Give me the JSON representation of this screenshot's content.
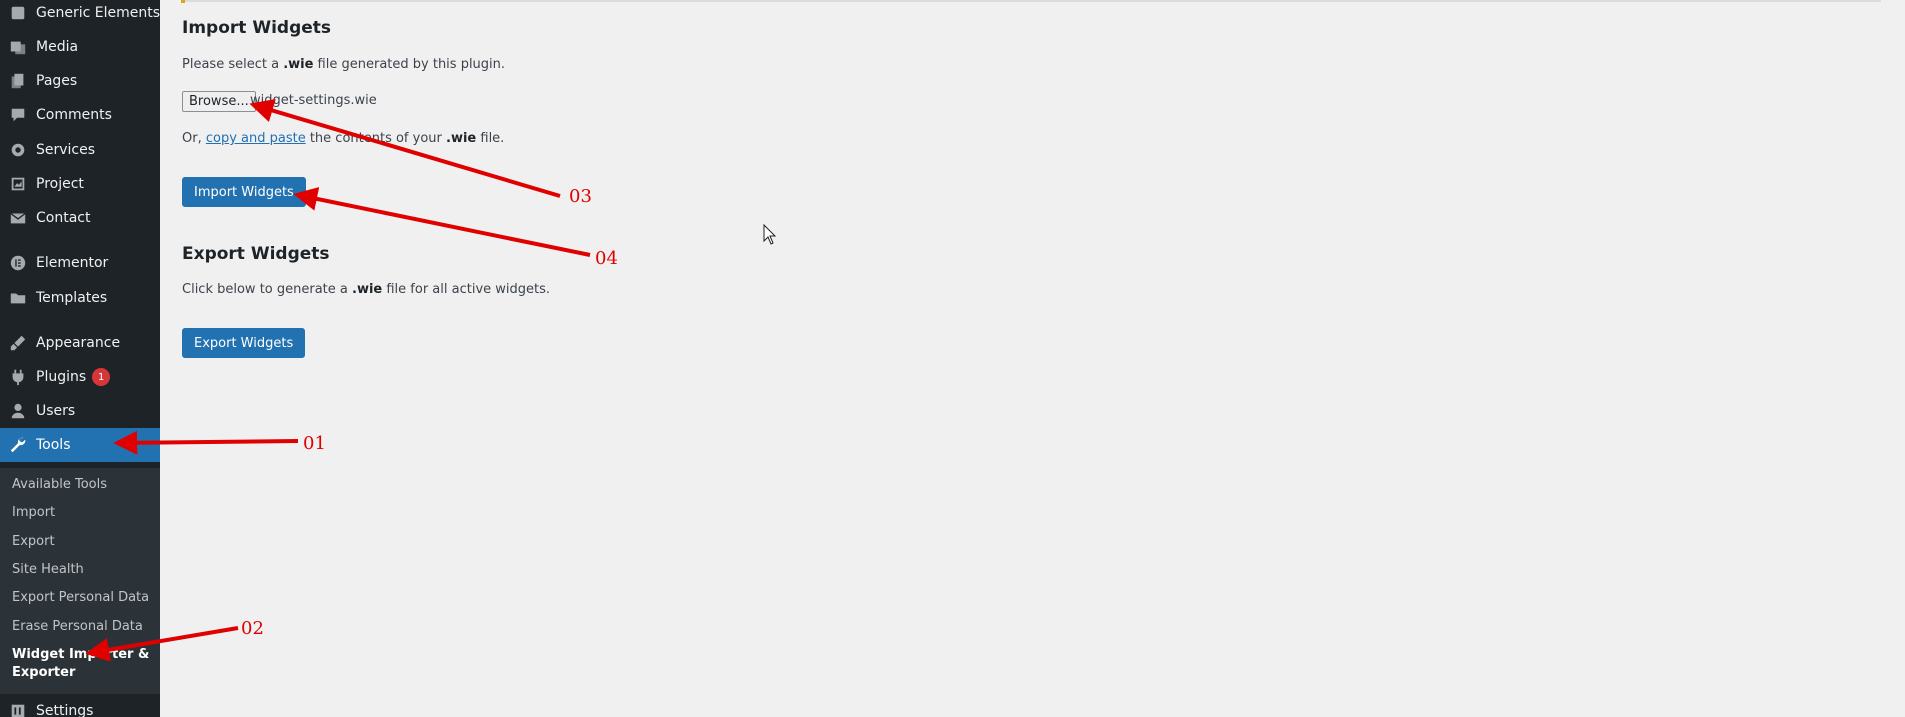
{
  "sidebar": {
    "items": [
      {
        "label": "Generic Elements",
        "icon": "generic-elements-icon"
      },
      {
        "label": "Media",
        "icon": "media-icon"
      },
      {
        "label": "Pages",
        "icon": "pages-icon"
      },
      {
        "label": "Comments",
        "icon": "comments-icon"
      },
      {
        "label": "Services",
        "icon": "gear-icon"
      },
      {
        "label": "Project",
        "icon": "project-icon"
      },
      {
        "label": "Contact",
        "icon": "envelope-icon"
      },
      {
        "label": "Elementor",
        "icon": "elementor-icon"
      },
      {
        "label": "Templates",
        "icon": "folder-icon"
      },
      {
        "label": "Appearance",
        "icon": "brush-icon"
      },
      {
        "label": "Plugins",
        "icon": "plugin-icon",
        "badge": "1"
      },
      {
        "label": "Users",
        "icon": "user-icon"
      },
      {
        "label": "Tools",
        "icon": "wrench-icon",
        "active": true
      }
    ],
    "submenu": [
      "Available Tools",
      "Import",
      "Export",
      "Site Health",
      "Export Personal Data",
      "Erase Personal Data",
      "Widget Importer &",
      "Exporter"
    ],
    "settings": {
      "label": "Settings",
      "icon": "settings-icon"
    }
  },
  "import": {
    "heading": "Import Widgets",
    "intro_pre": "Please select a ",
    "intro_bold": ".wie",
    "intro_post": " file generated by this plugin.",
    "browse_label": "Browse...",
    "file_name": "widget-settings.wie",
    "or_pre": "Or, ",
    "or_link": "copy and paste",
    "or_mid": " the contents of your ",
    "or_bold": ".wie",
    "or_post": " file.",
    "button_label": "Import Widgets"
  },
  "export": {
    "heading": "Export Widgets",
    "intro_pre": "Click below to generate a ",
    "intro_bold": ".wie",
    "intro_post": " file for all active widgets.",
    "button_label": "Export Widgets"
  },
  "annotations": [
    "01",
    "02",
    "03",
    "04"
  ],
  "colors": {
    "sidebar_bg": "#1d2327",
    "submenu_bg": "#2c3338",
    "accent": "#2271b1",
    "annotation": "#e00000",
    "badge": "#d63638"
  }
}
